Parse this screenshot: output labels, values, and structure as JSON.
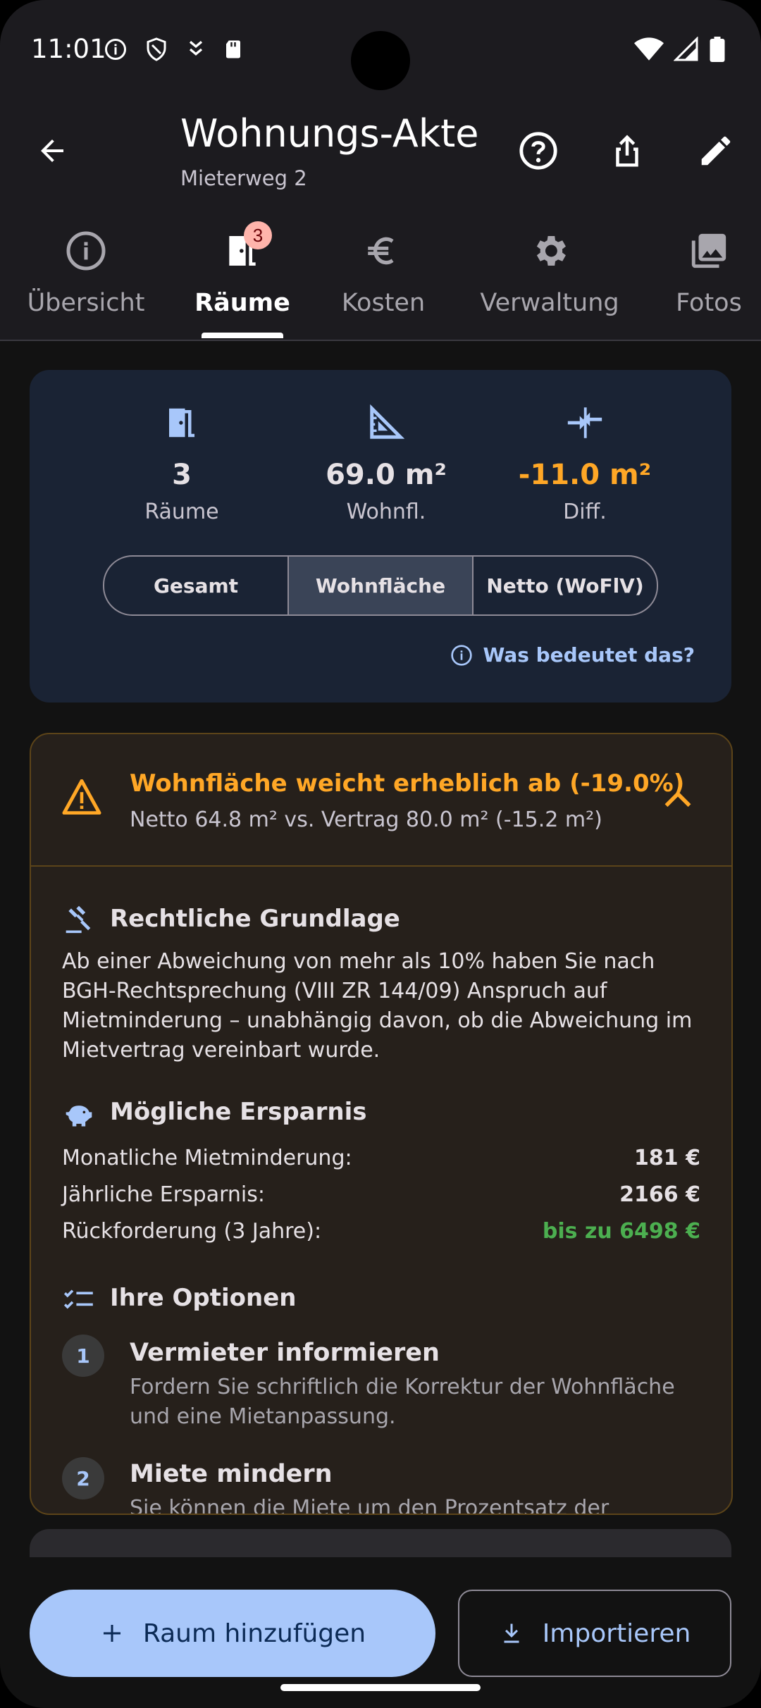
{
  "status": {
    "time": "11:01"
  },
  "appbar": {
    "title": "Wohnungs-Akte",
    "subtitle": "Mieterweg 2"
  },
  "tabs": [
    {
      "label": "Übersicht",
      "icon": "info-icon",
      "active": false
    },
    {
      "label": "Räume",
      "icon": "door-icon",
      "active": true,
      "badge": "3"
    },
    {
      "label": "Kosten",
      "icon": "euro-icon",
      "active": false
    },
    {
      "label": "Verwaltung",
      "icon": "gear-icon",
      "active": false
    },
    {
      "label": "Fotos",
      "icon": "photos-icon",
      "active": false
    }
  ],
  "summary": {
    "stats": [
      {
        "value": "3",
        "label": "Räume",
        "icon": "door-icon"
      },
      {
        "value": "69.0 m²",
        "label": "Wohnfl.",
        "icon": "triangle-ruler-icon"
      },
      {
        "value": "-11.0 m²",
        "label": "Diff.",
        "icon": "compare-arrows-icon",
        "color": "#ffa726"
      }
    ],
    "segments": [
      "Gesamt",
      "Wohnfläche",
      "Netto (WoFlV)"
    ],
    "selected_segment": "Wohnfläche",
    "info_link": "Was bedeutet das?"
  },
  "warning": {
    "title": "Wohnfläche weicht erheblich ab (-19.0%)",
    "subtitle": "Netto 64.8 m² vs. Vertrag 80.0 m² (-15.2 m²)",
    "legal": {
      "heading": "Rechtliche Grundlage",
      "lines": [
        "Ab einer Abweichung von mehr als 10% haben Sie nach",
        "BGH-Rechtsprechung (VIII ZR 144/09) Anspruch auf",
        "Mietminderung – unabhängig davon, ob die Abweichung im",
        "Mietvertrag vereinbart wurde."
      ]
    },
    "savings": {
      "heading": "Mögliche Ersparnis",
      "rows": [
        {
          "label": "Monatliche Mietminderung:",
          "value": "181 €"
        },
        {
          "label": "Jährliche Ersparnis:",
          "value": "2166 €"
        },
        {
          "label": "Rückforderung (3 Jahre):",
          "value": "bis zu 6498 €"
        }
      ]
    },
    "options": {
      "heading": "Ihre Optionen",
      "items": [
        {
          "num": "1",
          "title": "Vermieter informieren",
          "lines": [
            "Fordern Sie schriftlich die Korrektur der Wohnfläche",
            "und eine Mietanpassung."
          ]
        },
        {
          "num": "2",
          "title": "Miete mindern",
          "lines": [
            "Sie können die Miete um den Prozentsatz der"
          ]
        }
      ]
    }
  },
  "actions": {
    "add_room": "Raum hinzufügen",
    "import": "Importieren"
  },
  "colors": {
    "accent": "#a8c7fa",
    "warning": "#ffa726",
    "success": "#4caf50"
  }
}
